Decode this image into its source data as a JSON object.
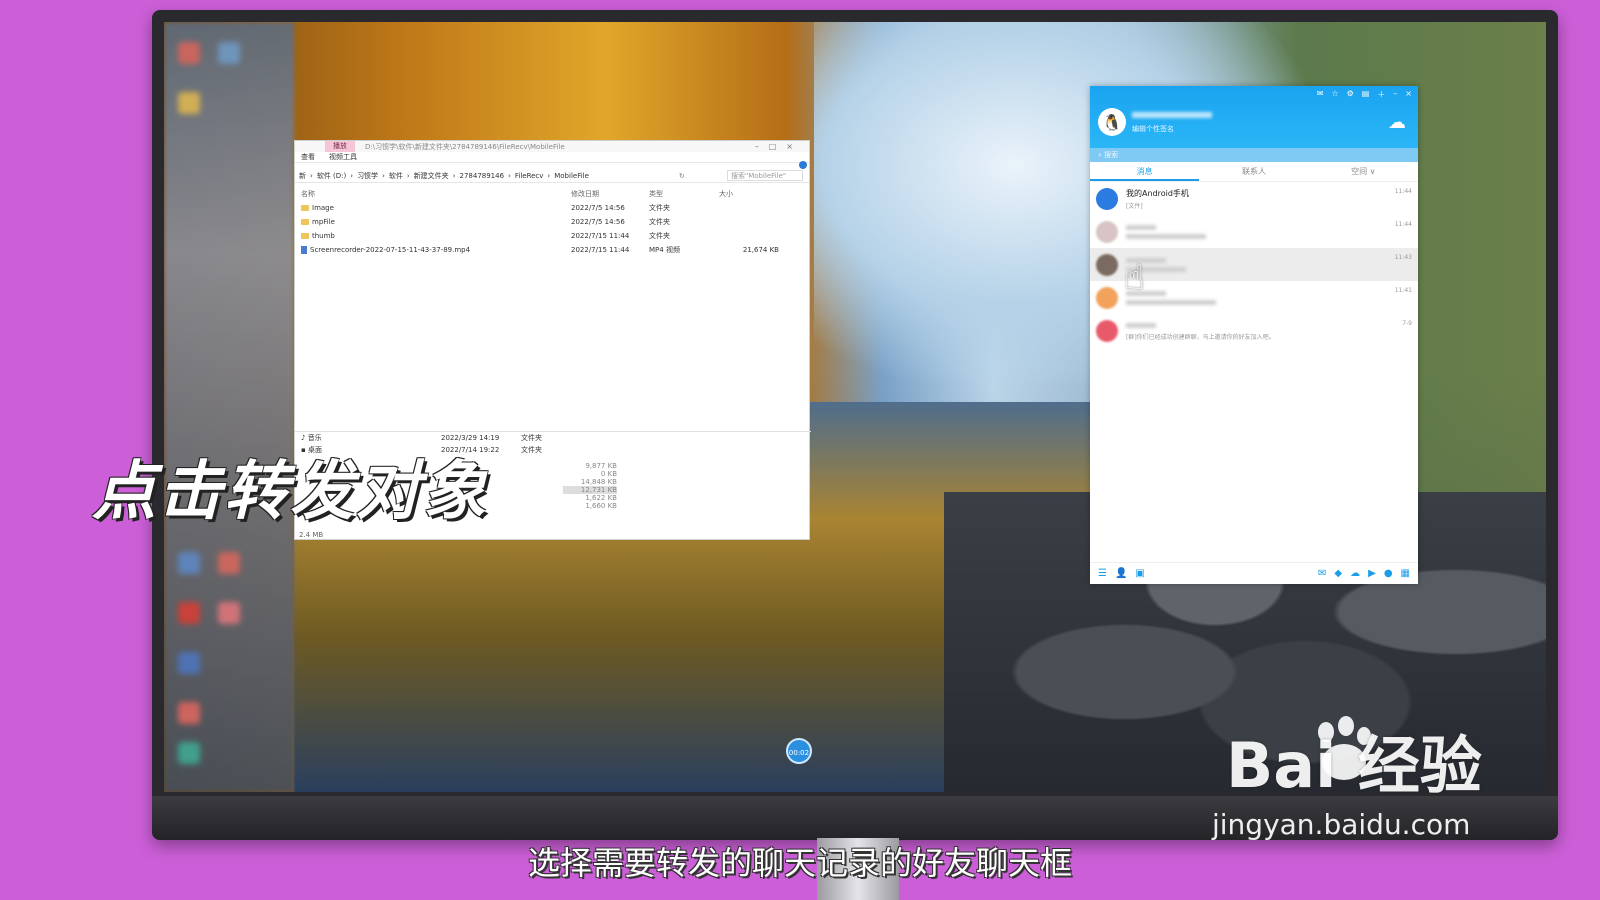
{
  "explorer": {
    "title_path": "D:\\习惯学\\软件\\新建文件夹\\2784789146\\FileRecv\\MobileFile",
    "tab_play": "播放",
    "ribbon_view": "查看",
    "ribbon_video_tools": "视频工具",
    "breadcrumb": [
      "新",
      "软件 (D:)",
      "习惯学",
      "软件",
      "新建文件夹",
      "2784789146",
      "FileRecv",
      "MobileFile"
    ],
    "search_placeholder": "搜索\"MobileFile\"",
    "columns": {
      "name": "名称",
      "date": "修改日期",
      "type": "类型",
      "size": "大小"
    },
    "files": [
      {
        "name": "Image",
        "date": "2022/7/5 14:56",
        "type": "文件夹",
        "size": ""
      },
      {
        "name": "mpFile",
        "date": "2022/7/5 14:56",
        "type": "文件夹",
        "size": ""
      },
      {
        "name": "thumb",
        "date": "2022/7/15 11:44",
        "type": "文件夹",
        "size": ""
      },
      {
        "name": "Screenrecorder-2022-07-15-11-43-37-89.mp4",
        "date": "2022/7/15 11:44",
        "type": "MP4 视频",
        "size": "21,674 KB"
      }
    ],
    "lower_rows": [
      {
        "name": "音乐",
        "date": "2022/3/29 14:19",
        "type": "文件夹",
        "size": ""
      },
      {
        "name": "桌面",
        "date": "2022/7/14 19:22",
        "type": "文件夹",
        "size": ""
      }
    ],
    "lower_sizes": [
      "9,877 KB",
      "0 KB",
      "14,848 KB",
      "12,731 KB",
      "1,622 KB",
      "1,660 KB"
    ],
    "status": "2.4 MB"
  },
  "qq": {
    "signature": "编辑个性签名",
    "search_placeholder": "搜索",
    "tabs": [
      "消息",
      "联系人",
      "空间 ∨"
    ],
    "messages": [
      {
        "name": "我的Android手机",
        "sub": "[文件]",
        "time": "11:44"
      },
      {
        "name": "",
        "sub": "",
        "time": "11:44"
      },
      {
        "name": "",
        "sub": "",
        "time": "11:43"
      },
      {
        "name": "",
        "sub": "",
        "time": "11:41"
      },
      {
        "name": "",
        "sub": "[群]你们已经成功创建群聊，马上邀请你的好友加入吧。",
        "time": "7-9"
      }
    ]
  },
  "timer": "00:02",
  "caption_big": "点击转发对象",
  "subtitle": "选择需要转发的聊天记录的好友聊天框",
  "watermark": {
    "brand": "Bai  经验",
    "url": "jingyan.baidu.com"
  },
  "colors": {
    "qq_blue": "#1aa3f0",
    "background": "#cc5fd8"
  }
}
